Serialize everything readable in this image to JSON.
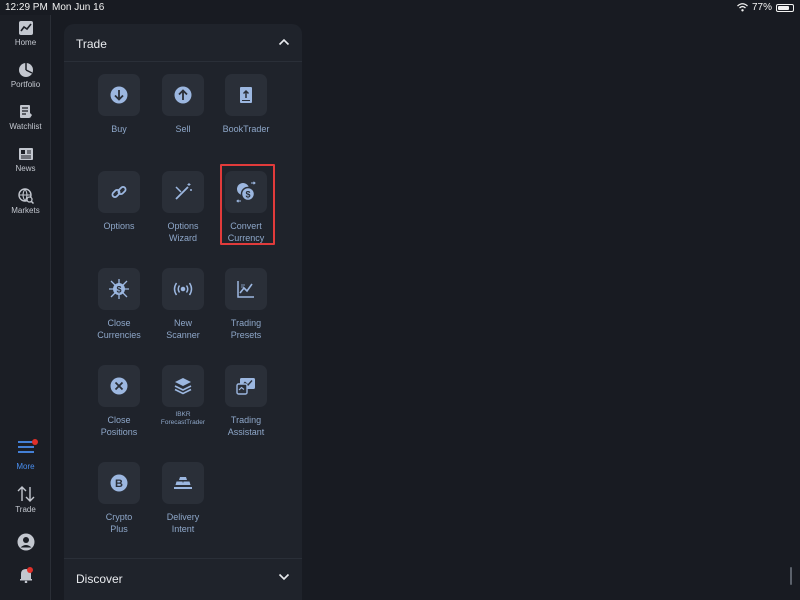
{
  "status": {
    "time": "12:29 PM",
    "date": "Mon Jun 16",
    "battery": "77%",
    "battery_level": 0.77
  },
  "rail": {
    "items": [
      {
        "label": "Home",
        "icon": "chart-icon"
      },
      {
        "label": "Portfolio",
        "icon": "pie-icon"
      },
      {
        "label": "Watchlist",
        "icon": "watchlist-icon"
      },
      {
        "label": "News",
        "icon": "newspaper-icon"
      },
      {
        "label": "Markets",
        "icon": "globe-search-icon"
      }
    ],
    "more_label": "More",
    "trade_label": "Trade",
    "accent": "#4a8ff0",
    "badge_color": "#e0302a"
  },
  "panel": {
    "title": "Trade",
    "discover_title": "Discover",
    "tiles": [
      {
        "label": "Buy",
        "icon": "arrow-down-icon"
      },
      {
        "label": "Sell",
        "icon": "arrow-up-icon"
      },
      {
        "label": "BookTrader",
        "icon": "book-icon"
      },
      {
        "label": "Options",
        "icon": "link-icon"
      },
      {
        "label": "Options\nWizard",
        "icon": "wand-icon"
      },
      {
        "label": "Convert\nCurrency",
        "icon": "currency-convert-icon"
      },
      {
        "label": "Close\nCurrencies",
        "icon": "close-currencies-icon"
      },
      {
        "label": "New\nScanner",
        "icon": "scanner-icon"
      },
      {
        "label": "Trading\nPresets",
        "icon": "presets-chart-icon"
      },
      {
        "label": "Close\nPositions",
        "icon": "close-circle-icon"
      },
      {
        "label": "IBKR\nForecastTrader",
        "icon": "layers-icon"
      },
      {
        "label": "Trading\nAssistant",
        "icon": "assistant-icon"
      },
      {
        "label": "Crypto\nPlus",
        "icon": "bitcoin-icon"
      },
      {
        "label": "Delivery\nIntent",
        "icon": "gold-bars-icon"
      }
    ]
  }
}
